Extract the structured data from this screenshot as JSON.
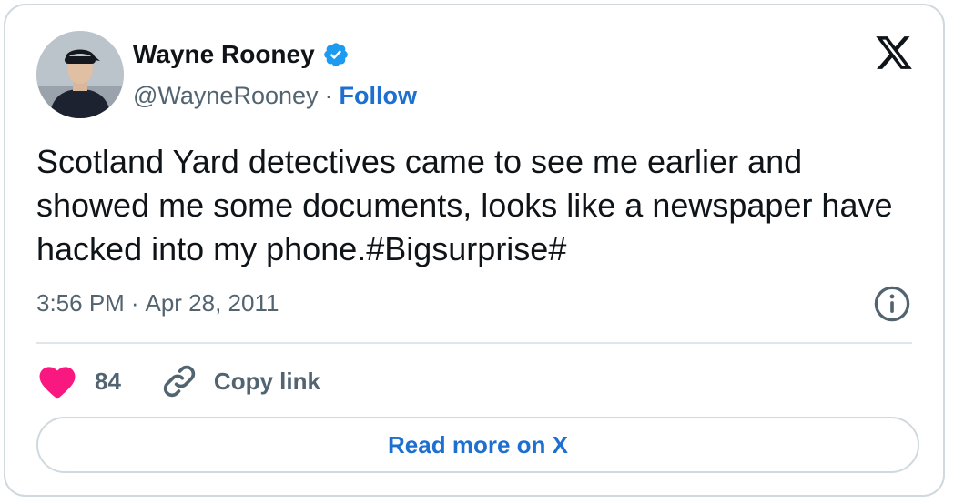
{
  "author": {
    "display_name": "Wayne Rooney",
    "handle": "@WayneRooney",
    "separator": "·",
    "follow_label": "Follow",
    "verified_icon": "verified-badge-icon"
  },
  "tweet": {
    "text": "Scotland Yard detectives came to see me earlier and showed me some documents, looks like a newspaper have hacked into my phone.#Bigsurprise#",
    "time": "3:56 PM",
    "separator": "·",
    "date": "Apr 28, 2011"
  },
  "actions": {
    "like_count": "84",
    "copy_link_label": "Copy link"
  },
  "footer": {
    "read_more_label": "Read more on X"
  },
  "colors": {
    "link_blue": "#1d6fd0",
    "verified_blue": "#1d9bf0",
    "heart_pink": "#f91880",
    "secondary_text": "#536471",
    "border": "#cfd9de"
  }
}
